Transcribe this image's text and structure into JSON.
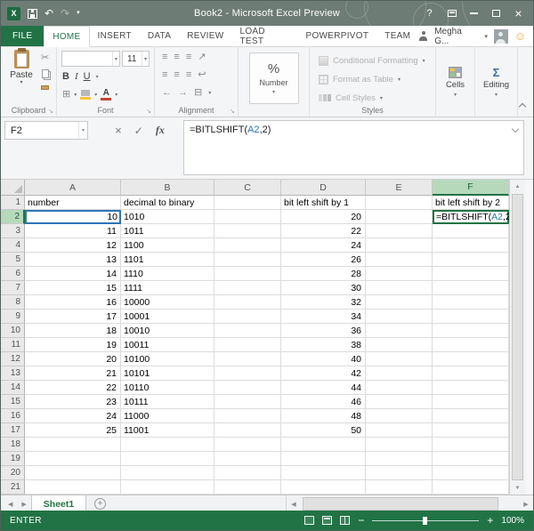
{
  "window": {
    "title": "Book2 - Microsoft Excel Preview"
  },
  "icons": {
    "excel": "X",
    "undo": "↶",
    "redo": "↷",
    "dropdown": "▾",
    "help": "?",
    "close": "×",
    "cut": "✂",
    "bold": "B",
    "italic": "I",
    "underline": "U",
    "borders": "⊞",
    "align_lines": "≡",
    "orientation": "↗",
    "wrap_text": "↩",
    "indent_left": "←",
    "indent_right": "→",
    "merge_center": "⊟",
    "percent": "%",
    "font_color": "A",
    "launcher": "↘",
    "cancel": "×",
    "enter": "✓",
    "fx": "fx",
    "sigma": "Σ",
    "sheet_prev": "◀",
    "sheet_next": "▶",
    "scroll_up": "▲",
    "scroll_down": "▼",
    "plus": "+",
    "minus": "−",
    "smiley": "☺"
  },
  "colors": {
    "accent_green": "#217346",
    "reference_blue": "#2e75b6"
  },
  "ribbon": {
    "tabs": [
      {
        "label": "FILE",
        "file": true
      },
      {
        "label": "HOME",
        "active": true
      },
      {
        "label": "INSERT"
      },
      {
        "label": "DATA"
      },
      {
        "label": "REVIEW"
      },
      {
        "label": "LOAD TEST"
      },
      {
        "label": "POWERPIVOT"
      },
      {
        "label": "TEAM"
      }
    ],
    "active_tab": "HOME",
    "user_name": "Megha G...",
    "groups": {
      "clipboard": {
        "label": "Clipboard",
        "paste": "Paste"
      },
      "font": {
        "label": "Font",
        "font_name": "",
        "font_size": "11"
      },
      "alignment": {
        "label": "Alignment"
      },
      "number": {
        "label": "Number"
      },
      "styles": {
        "label": "Styles",
        "conditional_formatting": "Conditional Formatting",
        "format_as_table": "Format as Table",
        "cell_styles": "Cell Styles"
      },
      "cells": {
        "label": "Cells"
      },
      "editing": {
        "label": "Editing"
      }
    }
  },
  "formula_bar": {
    "name_box": "F2",
    "formula": {
      "prefix": "=BITLSHIFT(",
      "ref": "A2",
      "suffix": ",2)"
    }
  },
  "grid": {
    "columns": [
      "A",
      "B",
      "C",
      "D",
      "E",
      "F"
    ],
    "selected_column": "F",
    "selected_row": 2,
    "active_cell": "F2",
    "reference_cell": "A2",
    "rows": [
      {
        "n": 1,
        "A": "number",
        "B": "decimal to binary",
        "D": "bit left shift by 1",
        "F": "bit left shift by 2"
      },
      {
        "n": 2,
        "A": "10",
        "B": "1010",
        "D": "20",
        "F": "=BITLSHIFT(A2,2)"
      },
      {
        "n": 3,
        "A": "11",
        "B": "1011",
        "D": "22"
      },
      {
        "n": 4,
        "A": "12",
        "B": "1100",
        "D": "24"
      },
      {
        "n": 5,
        "A": "13",
        "B": "1101",
        "D": "26"
      },
      {
        "n": 6,
        "A": "14",
        "B": "1110",
        "D": "28"
      },
      {
        "n": 7,
        "A": "15",
        "B": "1111",
        "D": "30"
      },
      {
        "n": 8,
        "A": "16",
        "B": "10000",
        "D": "32"
      },
      {
        "n": 9,
        "A": "17",
        "B": "10001",
        "D": "34"
      },
      {
        "n": 10,
        "A": "18",
        "B": "10010",
        "D": "36"
      },
      {
        "n": 11,
        "A": "19",
        "B": "10011",
        "D": "38"
      },
      {
        "n": 12,
        "A": "20",
        "B": "10100",
        "D": "40"
      },
      {
        "n": 13,
        "A": "21",
        "B": "10101",
        "D": "42"
      },
      {
        "n": 14,
        "A": "22",
        "B": "10110",
        "D": "44"
      },
      {
        "n": 15,
        "A": "23",
        "B": "10111",
        "D": "46"
      },
      {
        "n": 16,
        "A": "24",
        "B": "11000",
        "D": "48"
      },
      {
        "n": 17,
        "A": "25",
        "B": "11001",
        "D": "50"
      },
      {
        "n": 18
      },
      {
        "n": 19
      },
      {
        "n": 20
      },
      {
        "n": 21
      }
    ]
  },
  "sheet_bar": {
    "tabs": [
      {
        "label": "Sheet1",
        "active": true
      }
    ]
  },
  "status_bar": {
    "mode": "ENTER",
    "zoom": "100%"
  }
}
